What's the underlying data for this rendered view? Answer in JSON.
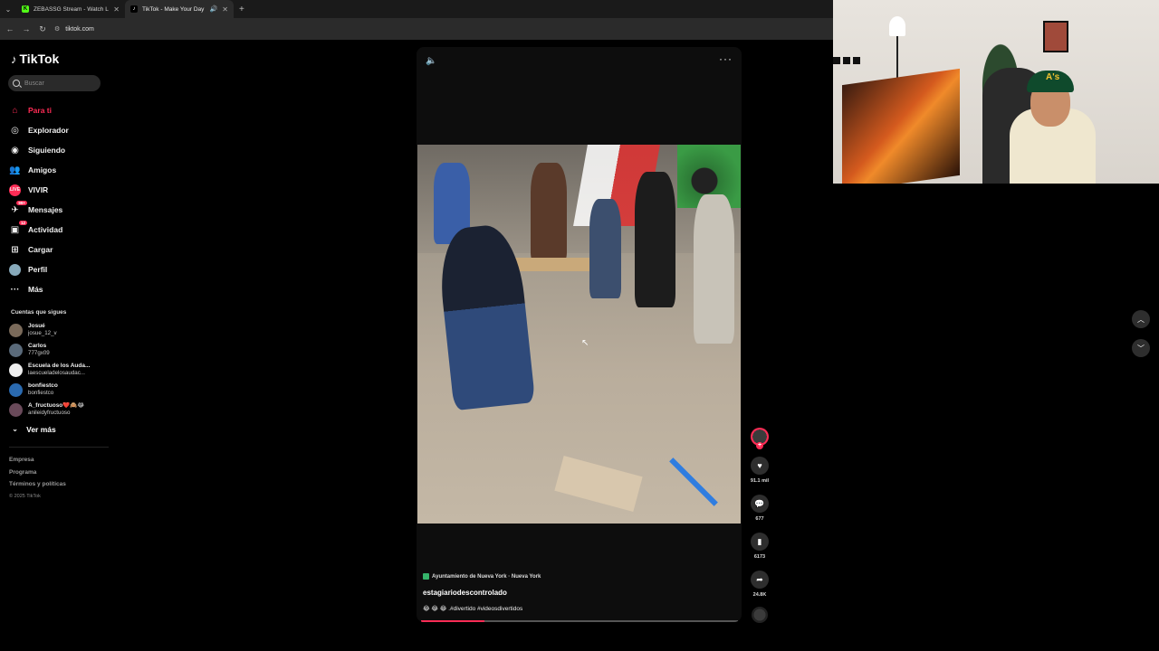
{
  "browser": {
    "tabs": [
      {
        "title": "ZEBASSG Stream - Watch Live o",
        "active": false
      },
      {
        "title": "TikTok - Make Your Day",
        "active": true
      }
    ],
    "url": "tiktok.com"
  },
  "sidebar": {
    "logo": "TikTok",
    "search_placeholder": "Buscar",
    "nav": [
      {
        "label": "Para ti",
        "icon": "home-icon",
        "active": true
      },
      {
        "label": "Explorador",
        "icon": "compass-icon"
      },
      {
        "label": "Siguiendo",
        "icon": "following-icon"
      },
      {
        "label": "Amigos",
        "icon": "friends-icon"
      },
      {
        "label": "VIVIR",
        "icon": "live-icon"
      },
      {
        "label": "Mensajes",
        "icon": "messages-icon",
        "badge": "99+"
      },
      {
        "label": "Actividad",
        "icon": "activity-icon",
        "badge": "12"
      },
      {
        "label": "Cargar",
        "icon": "upload-icon"
      },
      {
        "label": "Perfil",
        "icon": "profile-icon"
      },
      {
        "label": "Más",
        "icon": "more-icon"
      }
    ],
    "following_title": "Cuentas que sigues",
    "following": [
      {
        "name": "Josué",
        "handle": "josue_12_v"
      },
      {
        "name": "Carlos",
        "handle": "777gx09"
      },
      {
        "name": "Escuela de los Auda...",
        "handle": "laescueladelosaudac..."
      },
      {
        "name": "bonfiestco",
        "handle": "bonfiestco"
      },
      {
        "name": "A_fructuoso❤️🙈😂",
        "handle": "anileidyfructuoso"
      }
    ],
    "see_more": "Ver más",
    "footer": [
      "Empresa",
      "Programa",
      "Términos y políticas"
    ],
    "copyright": "© 2025 TikTok"
  },
  "video": {
    "location": "Ayuntamiento de Nueva York · Nueva York",
    "author": "estagiariodescontrolado",
    "description": "😂 😂 😂 .#divertido #videosdivertidos",
    "progress": 0.2
  },
  "actions": {
    "likes": "91.1 mil",
    "comments": "677",
    "saves": "6173",
    "shares": "24.8K"
  },
  "colors": {
    "accent": "#fe2c55",
    "background": "#000000"
  }
}
